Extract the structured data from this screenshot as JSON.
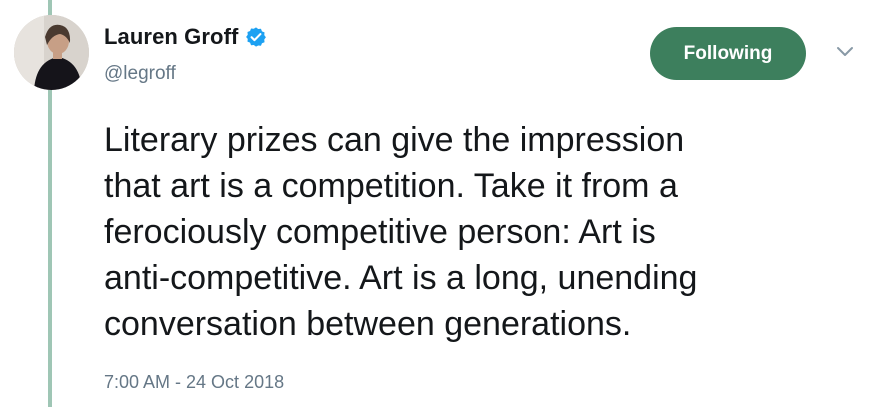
{
  "author": {
    "display_name": "Lauren Groff",
    "handle": "@legroff",
    "verified": true,
    "verified_icon": "verified-badge-icon"
  },
  "follow_button": {
    "label": "Following",
    "color": "#3d7f5d"
  },
  "menu": {
    "icon": "chevron-down-icon"
  },
  "tweet": {
    "text": "Literary prizes can give the impression\nthat art is a competition. Take it from a\nferociously competitive person: Art is\nanti-competitive. Art is a long, unending\nconversation between generations.",
    "timestamp": "7:00 AM - 24 Oct 2018"
  },
  "colors": {
    "thread_line": "#9fc6b5",
    "verified_badge": "#1da1f2",
    "secondary_text": "#657786",
    "primary_text": "#14171a"
  }
}
